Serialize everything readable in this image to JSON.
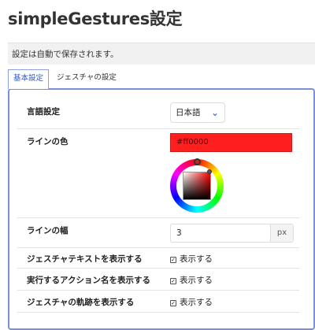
{
  "page": {
    "title": "simpleGestures設定"
  },
  "notice": {
    "text": "設定は自動で保存されます。"
  },
  "tabs": [
    {
      "label": "基本設定",
      "active": true
    },
    {
      "label": "ジェスチャの設定",
      "active": false
    }
  ],
  "settings": {
    "language": {
      "label": "言語設定",
      "value": "日本語"
    },
    "line_color": {
      "label": "ラインの色",
      "value": "#ff0000",
      "swatch": "#ff1f1f"
    },
    "line_width": {
      "label": "ラインの幅",
      "value": "3",
      "unit": "px"
    },
    "show_gesture_text": {
      "label": "ジェスチャテキストを表示する",
      "checkbox_label": "表示する",
      "checked": true
    },
    "show_action_name": {
      "label": "実行するアクション名を表示する",
      "checkbox_label": "表示する",
      "checked": true
    },
    "show_trail": {
      "label": "ジェスチャの軌跡を表示する",
      "checkbox_label": "表示する",
      "checked": true
    }
  },
  "colors": {
    "accent": "#3356c8",
    "panel_border": "#7b8fd8"
  },
  "icons": {
    "select_arrow": "chevron-down-icon",
    "checkbox_mark": "check-icon"
  }
}
